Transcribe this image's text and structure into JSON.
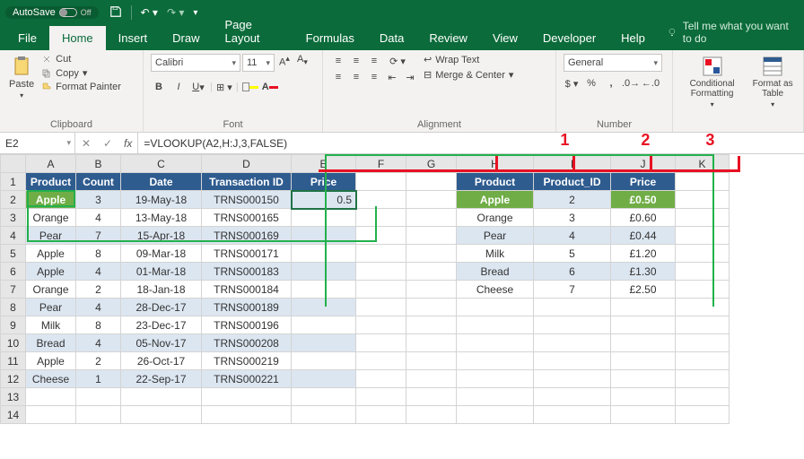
{
  "titlebar": {
    "autosave": "AutoSave",
    "off": "Off"
  },
  "tabs": [
    "File",
    "Home",
    "Insert",
    "Draw",
    "Page Layout",
    "Formulas",
    "Data",
    "Review",
    "View",
    "Developer",
    "Help"
  ],
  "active_tab": "Home",
  "tellme": "Tell me what you want to do",
  "ribbon": {
    "clipboard": {
      "label": "Clipboard",
      "paste": "Paste",
      "cut": "Cut",
      "copy": "Copy",
      "fp": "Format Painter"
    },
    "font": {
      "label": "Font",
      "name": "Calibri",
      "size": "11"
    },
    "alignment": {
      "label": "Alignment",
      "wrap": "Wrap Text",
      "merge": "Merge & Center"
    },
    "number": {
      "label": "Number",
      "format": "General"
    },
    "cond": "Conditional Formatting",
    "fmt": "Format as Table"
  },
  "namebox": "E2",
  "formula": "=VLOOKUP(A2,H:J,3,FALSE)",
  "annotations": {
    "a1": "1",
    "a2": "2",
    "a3": "3"
  },
  "cols": [
    "A",
    "B",
    "C",
    "D",
    "E",
    "F",
    "G",
    "H",
    "I",
    "J",
    "K"
  ],
  "headers1": [
    "Product",
    "Count",
    "Date",
    "Transaction ID",
    "Price"
  ],
  "headers2": [
    "Product",
    "Product_ID",
    "Price"
  ],
  "rows1": [
    [
      "Apple",
      "3",
      "19-May-18",
      "TRNS000150",
      "0.5"
    ],
    [
      "Orange",
      "4",
      "13-May-18",
      "TRNS000165",
      ""
    ],
    [
      "Pear",
      "7",
      "15-Apr-18",
      "TRNS000169",
      ""
    ],
    [
      "Apple",
      "8",
      "09-Mar-18",
      "TRNS000171",
      ""
    ],
    [
      "Apple",
      "4",
      "01-Mar-18",
      "TRNS000183",
      ""
    ],
    [
      "Orange",
      "2",
      "18-Jan-18",
      "TRNS000184",
      ""
    ],
    [
      "Pear",
      "4",
      "28-Dec-17",
      "TRNS000189",
      ""
    ],
    [
      "Milk",
      "8",
      "23-Dec-17",
      "TRNS000196",
      ""
    ],
    [
      "Bread",
      "4",
      "05-Nov-17",
      "TRNS000208",
      ""
    ],
    [
      "Apple",
      "2",
      "26-Oct-17",
      "TRNS000219",
      ""
    ],
    [
      "Cheese",
      "1",
      "22-Sep-17",
      "TRNS000221",
      ""
    ]
  ],
  "rows2": [
    [
      "Apple",
      "2",
      "£0.50"
    ],
    [
      "Orange",
      "3",
      "£0.60"
    ],
    [
      "Pear",
      "4",
      "£0.44"
    ],
    [
      "Milk",
      "5",
      "£1.20"
    ],
    [
      "Bread",
      "6",
      "£1.30"
    ],
    [
      "Cheese",
      "7",
      "£2.50"
    ]
  ]
}
